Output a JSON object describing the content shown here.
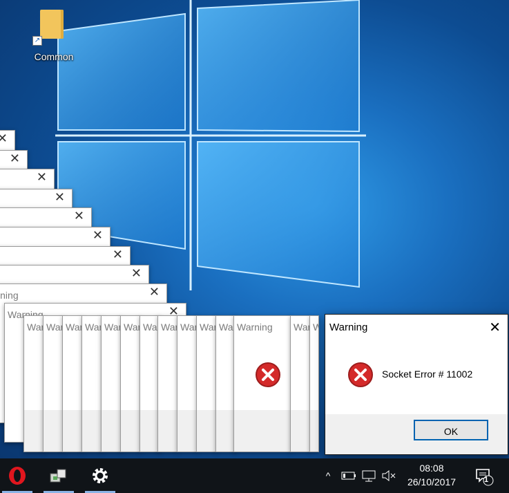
{
  "desktop": {
    "icons": [
      {
        "label": "Common",
        "icon": "folder-shortcut-icon"
      }
    ]
  },
  "dialogs": {
    "background_title": "Warning",
    "main": {
      "title": "Warning",
      "message": "Socket Error # 11002",
      "ok_label": "OK",
      "icon": "error-icon"
    }
  },
  "taskbar": {
    "apps": [
      "opera-icon",
      "network-app-icon",
      "settings-icon"
    ],
    "tray": [
      "chevron-up-icon",
      "battery-icon",
      "network-icon",
      "volume-muted-icon"
    ],
    "time": "08:08",
    "date": "26/10/2017",
    "notification_count": "1"
  },
  "colors": {
    "accent": "#0063b1",
    "taskbar": "#101418",
    "error_red": "#d42a2a"
  }
}
